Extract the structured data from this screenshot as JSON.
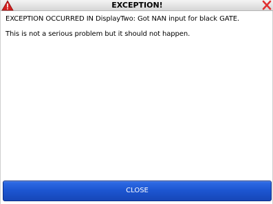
{
  "window": {
    "title": "EXCEPTION!",
    "title_icon": "warning-icon",
    "close_icon": "close-icon"
  },
  "message": {
    "line1": "EXCEPTION OCCURRED IN DisplayTwo: Got NAN input for black GATE.",
    "line2": "This is not a serious problem but it should not happen."
  },
  "buttons": {
    "close_label": "CLOSE"
  },
  "colors": {
    "button_blue": "#1d56d2",
    "warning_red": "#d42020",
    "close_red": "#e03030"
  }
}
